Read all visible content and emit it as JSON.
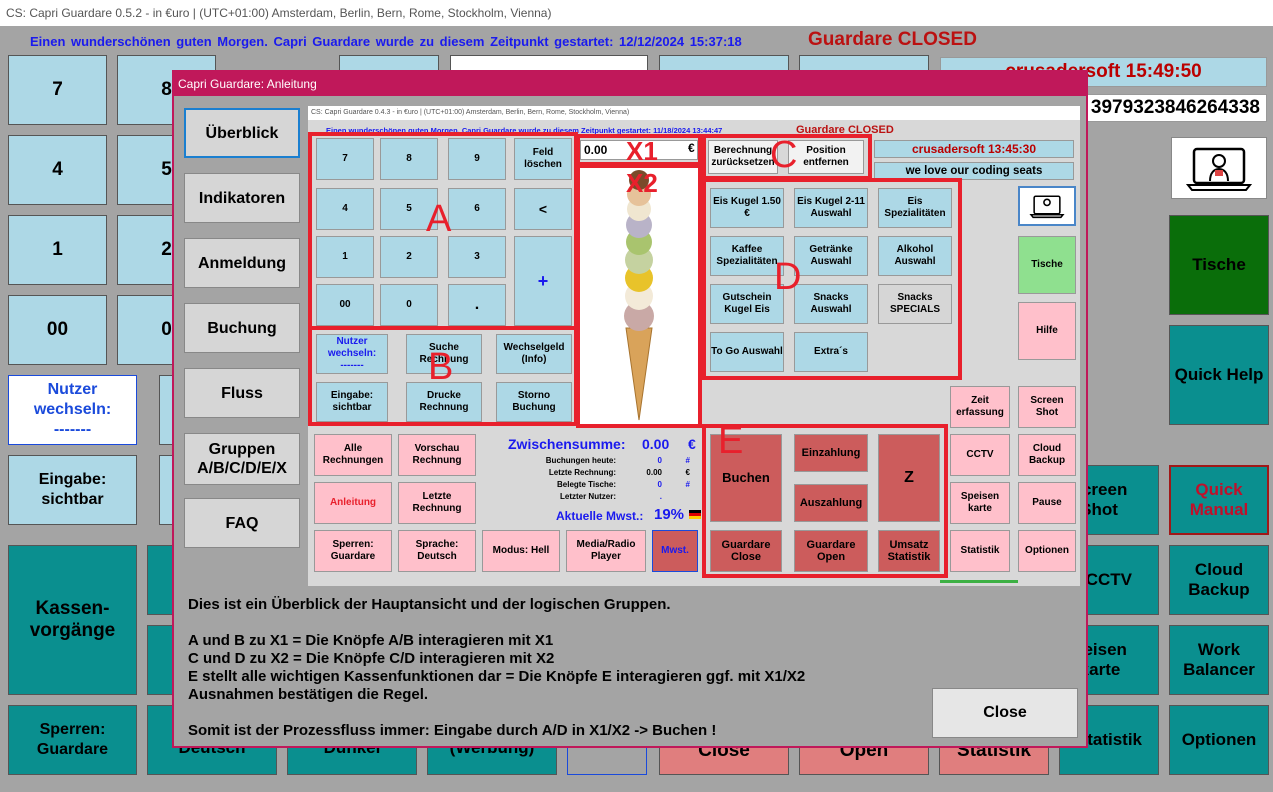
{
  "window_title": "CS: Capri Guardare 0.5.2 - in €uro  |  (UTC+01:00) Amsterdam, Berlin, Bern, Rome, Stockholm, Vienna)",
  "greeting": "Einen wunderschönen guten Morgen. Capri Guardare wurde zu diesem Zeitpunkt gestartet: 12/12/2024 15:37:18",
  "status": "Guardare CLOSED",
  "clock": "crusadersoft 15:49:50",
  "number_display": "3979323846264338",
  "keypad": [
    "7",
    "8",
    "4",
    "5",
    "1",
    "2",
    "00",
    "0"
  ],
  "left_buttons": {
    "nutzer": "Nutzer wechseln:",
    "nutzer_value": "-------",
    "eingabe": "Eingabe: sichtbar",
    "kassen": "Kassen-vorgänge",
    "sperren": "Sperren: Guardare"
  },
  "right_buttons": {
    "tische": "Tische",
    "quick_help": "Quick Help",
    "screen_shot": "Screen Shot",
    "quick_manual": "Quick Manual",
    "cctv": "CCTV",
    "cloud_backup": "Cloud Backup",
    "speisenkarte": "peisen karte",
    "work_balancer": "Work Balancer",
    "statistik": "tatistik",
    "optionen": "Optionen"
  },
  "bottom_partial": {
    "deutsch": "Deutsch",
    "dunkel": "Dunkel",
    "werbung": "(Werbung)",
    "close": "Close",
    "open": "Open",
    "statistik": "Statistik"
  },
  "dialog": {
    "title": "Capri Guardare: Anleitung",
    "nav": [
      "Überblick",
      "Indikatoren",
      "Anmeldung",
      "Buchung",
      "Fluss",
      "Gruppen A/B/C/D/E/X",
      "FAQ"
    ],
    "close": "Close",
    "description": [
      "Dies ist ein Überblick der Hauptansicht und der logischen Gruppen.",
      "A und B zu X1 = Die Knöpfe A/B interagieren mit X1",
      "C und D zu X2 = Die Knöpfe C/D interagieren mit X2",
      "E stellt alle wichtigen Kassenfunktionen dar = Die Knöpfe E interagieren ggf. mit X1/X2",
      "Ausnahmen bestätigen die Regel.",
      "Somit ist der Prozessfluss immer: Eingabe durch A/D in X1/X2 -> Buchen !"
    ]
  },
  "shot": {
    "title": "CS: Capri Guardare 0.4.3 - in €uro  |  (UTC+01:00) Amsterdam, Berlin, Bern, Rome, Stockholm, Vienna)",
    "greeting": "Einen wunderschönen guten Morgen. Capri Guardare wurde zu diesem Zeitpunkt gestartet: 11/18/2024 13:44:47",
    "status": "Guardare CLOSED",
    "clock": "crusadersoft 13:45:30",
    "slogan": "we love our coding seats",
    "x1_value": "0.00",
    "euro": "€",
    "keys": [
      "7",
      "8",
      "9",
      "Feld löschen",
      "4",
      "5",
      "6",
      "<",
      "1",
      "2",
      "3",
      "+",
      "00",
      "0",
      "."
    ],
    "b_buttons": [
      "Nutzer wechseln:",
      "-------",
      "Suche Rechnung",
      "Wechselgeld (Info)",
      "Eingabe: sichtbar",
      "Drucke Rechnung",
      "Storno Buchung"
    ],
    "c_buttons": [
      "Berechnung zurücksetzen",
      "Position entfernen"
    ],
    "d_buttons": [
      "Eis Kugel 1.50 €",
      "Eis Kugel 2-11 Auswahl",
      "Eis Spezialitäten",
      "Kaffee Spezialitäten",
      "Getränke Auswahl",
      "Alkohol Auswahl",
      "Gutschein Kugel Eis",
      "Snacks Auswahl",
      "Snacks SPECIALS",
      "To Go Auswahl",
      "Extra´s"
    ],
    "side": [
      "Tische",
      "Hilfe",
      "Zeit erfassung",
      "Screen Shot",
      "CCTV",
      "Cloud Backup",
      "Speisen karte",
      "Pause",
      "Statistik",
      "Optionen"
    ],
    "pink": [
      "Alle Rechnungen",
      "Vorschau Rechnung",
      "Anleitung",
      "Letzte Rechnung",
      "Sperren: Guardare",
      "Sprache: Deutsch",
      "Modus: Hell",
      "Media/Radio Player",
      "Mwst."
    ],
    "zwischensumme_label": "Zwischensumme:",
    "zwischensumme_value": "0.00",
    "stats": [
      [
        "Buchungen heute:",
        "0",
        "#"
      ],
      [
        "Letzte Rechnung:",
        "0.00",
        "€"
      ],
      [
        "Belegte Tische:",
        "0",
        "#"
      ],
      [
        "Letzter Nutzer:",
        ".",
        ""
      ]
    ],
    "mwst_label": "Aktuelle Mwst.:",
    "mwst_value": "19%",
    "e_buttons": [
      "Buchen",
      "Einzahlung",
      "Z",
      "Auszahlung",
      "Guardare Close",
      "Guardare Open",
      "Umsatz Statistik"
    ],
    "labels": [
      "A",
      "B",
      "C",
      "D",
      "E",
      "X1",
      "X2"
    ]
  }
}
